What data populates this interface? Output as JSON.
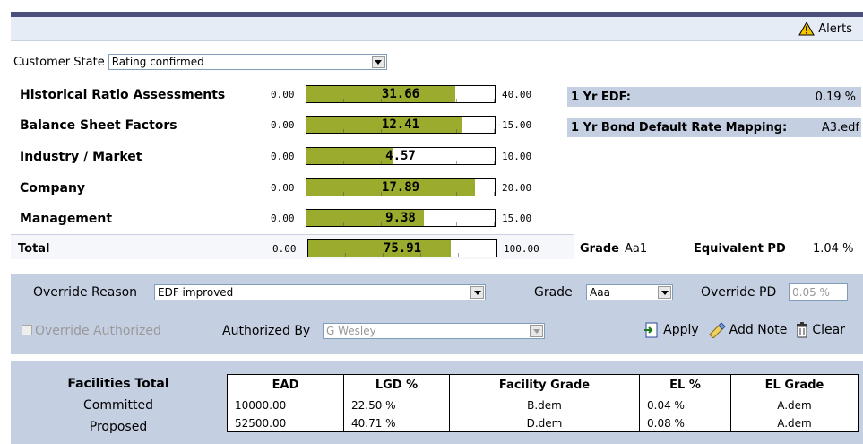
{
  "alerts": {
    "label": "Alerts"
  },
  "customer_state": {
    "label": "Customer State",
    "value": "Rating confirmed"
  },
  "assessments": [
    {
      "label": "Historical Ratio Assessments",
      "min": "0.00",
      "value": "31.66",
      "max": "40.00",
      "fraction": 0.7915
    },
    {
      "label": "Balance Sheet Factors",
      "min": "0.00",
      "value": "12.41",
      "max": "15.00",
      "fraction": 0.8273
    },
    {
      "label": "Industry / Market",
      "min": "0.00",
      "value": "4.57",
      "max": "10.00",
      "fraction": 0.457
    },
    {
      "label": "Company",
      "min": "0.00",
      "value": "17.89",
      "max": "20.00",
      "fraction": 0.8945
    },
    {
      "label": "Management",
      "min": "0.00",
      "value": "9.38",
      "max": "15.00",
      "fraction": 0.6253
    }
  ],
  "total": {
    "label": "Total",
    "min": "0.00",
    "value": "75.91",
    "max": "100.00",
    "fraction": 0.7591
  },
  "edf": {
    "one_yr_label": "1 Yr EDF:",
    "one_yr_value": "0.19 %",
    "bond_label": "1 Yr Bond Default Rate Mapping:",
    "bond_value": "A3.edf"
  },
  "grade_summary": {
    "grade_label": "Grade",
    "grade_value": "Aa1",
    "pd_label": "Equivalent PD",
    "pd_value": "1.04 %"
  },
  "override": {
    "reason_label": "Override Reason",
    "reason_value": "EDF improved",
    "grade_label": "Grade",
    "grade_value": "Aaa",
    "pd_label": "Override PD",
    "pd_placeholder": "0.05 %",
    "authorized_label": "Override Authorized",
    "authorized_by_label": "Authorized By",
    "authorized_by_value": "G Wesley",
    "apply": "Apply",
    "add_note": "Add Note",
    "clear": "Clear"
  },
  "facilities": {
    "title": "Facilities Total",
    "columns": [
      "EAD",
      "LGD %",
      "Facility Grade",
      "EL %",
      "EL Grade"
    ],
    "rows": [
      {
        "label": "Committed",
        "cells": [
          "10000.00",
          "22.50 %",
          "B.dem",
          "0.04 %",
          "A.dem"
        ]
      },
      {
        "label": "Proposed",
        "cells": [
          "52500.00",
          "40.71 %",
          "D.dem",
          "0.08 %",
          "A.dem"
        ]
      }
    ]
  },
  "colors": {
    "bar_fill": "#9aab2e",
    "panel": "#c5cfe2",
    "topbar": "#4a4f7c"
  }
}
